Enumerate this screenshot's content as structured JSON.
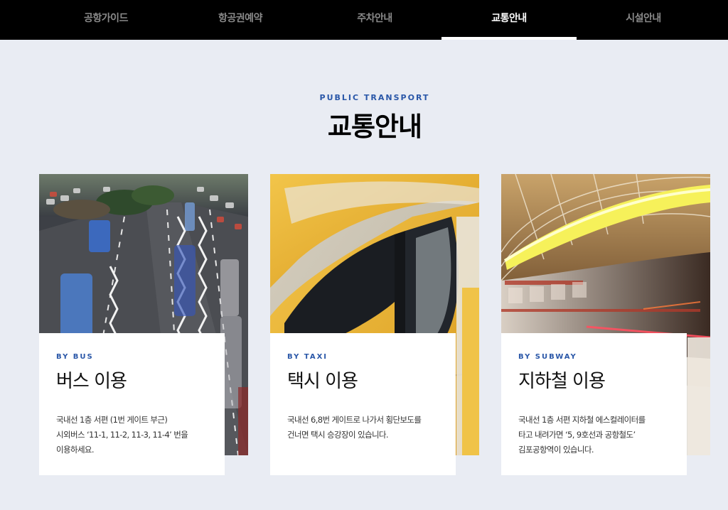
{
  "nav": {
    "items": [
      {
        "label": "공항가이드",
        "active": false
      },
      {
        "label": "항공권예약",
        "active": false
      },
      {
        "label": "주차안내",
        "active": false
      },
      {
        "label": "교통안내",
        "active": true
      },
      {
        "label": "시설안내",
        "active": false
      }
    ]
  },
  "section": {
    "eyebrow": "PUBLIC TRANSPORT",
    "title": "교통안내"
  },
  "cards": [
    {
      "by": "BY BUS",
      "title": "버스 이용",
      "desc": [
        "국내선 1층 서편 (1번 게이트 부근)",
        "시외버스 ‘11-1, 11-2, 11-3, 11-4’ 번을",
        "이용하세요."
      ]
    },
    {
      "by": "BY TAXI",
      "title": "택시 이용",
      "desc": [
        "국내선 6,8번 게이트로 나가서 횡단보도를",
        "건너면 택시 승강장이 있습니다."
      ]
    },
    {
      "by": "BY SUBWAY",
      "title": "지하철 이용",
      "desc": [
        "국내선 1층 서편 지하철 에스컬레이터를",
        "타고 내려가면 ‘5, 9호선과 공항철도’",
        "김포공항역이 있습니다."
      ]
    }
  ],
  "colors": {
    "nav_bg": "#000000",
    "page_bg": "#e9ecf3",
    "accent": "#2a57a8"
  }
}
